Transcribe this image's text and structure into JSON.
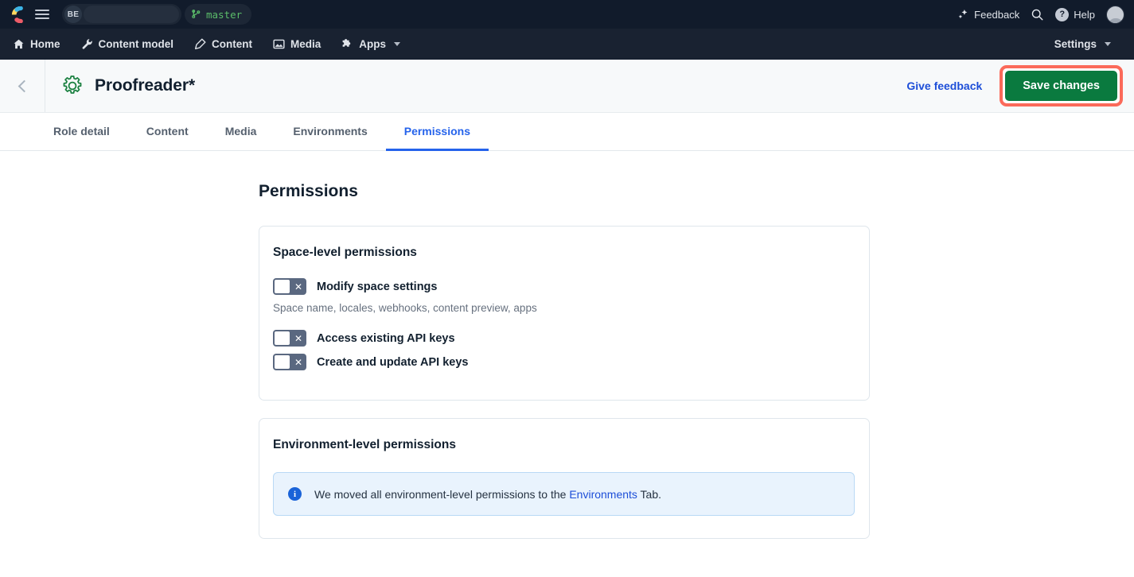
{
  "topbar": {
    "logo": "contentful-logo",
    "menu_icon": "hamburger-icon",
    "space_initials": "BE",
    "branch_label": "master",
    "branch_icon": "git-branch-icon",
    "feedback_label": "Feedback",
    "feedback_icon": "sparkle-icon",
    "search_icon": "search-icon",
    "help_label": "Help",
    "help_icon": "question-mark-icon",
    "avatar": "user-avatar"
  },
  "nav": {
    "items": [
      {
        "label": "Home",
        "icon": "home-icon"
      },
      {
        "label": "Content model",
        "icon": "wrench-icon"
      },
      {
        "label": "Content",
        "icon": "pen-icon"
      },
      {
        "label": "Media",
        "icon": "image-icon"
      },
      {
        "label": "Apps",
        "icon": "puzzle-icon",
        "has_caret": true
      }
    ],
    "settings_label": "Settings"
  },
  "header": {
    "back_icon": "chevron-left-icon",
    "role_icon": "gear-icon",
    "title": "Proofreader*",
    "give_feedback_label": "Give feedback",
    "save_label": "Save changes",
    "save_bg": "#0a7a3f",
    "highlight_color": "#fb6a5a"
  },
  "tabs": [
    {
      "label": "Role detail",
      "active": false
    },
    {
      "label": "Content",
      "active": false
    },
    {
      "label": "Media",
      "active": false
    },
    {
      "label": "Environments",
      "active": false
    },
    {
      "label": "Permissions",
      "active": true
    }
  ],
  "main": {
    "page_title": "Permissions",
    "space_card": {
      "title": "Space-level permissions",
      "rows": [
        {
          "label": "Modify space settings",
          "state": "off",
          "help": "Space name, locales, webhooks, content preview, apps"
        },
        {
          "label": "Access existing API keys",
          "state": "off"
        },
        {
          "label": "Create and update API keys",
          "state": "off"
        }
      ]
    },
    "env_card": {
      "title": "Environment-level permissions",
      "note_icon": "info-icon",
      "note_prefix": "We moved all environment-level permissions to the ",
      "note_link": "Environments",
      "note_suffix": " Tab."
    }
  }
}
